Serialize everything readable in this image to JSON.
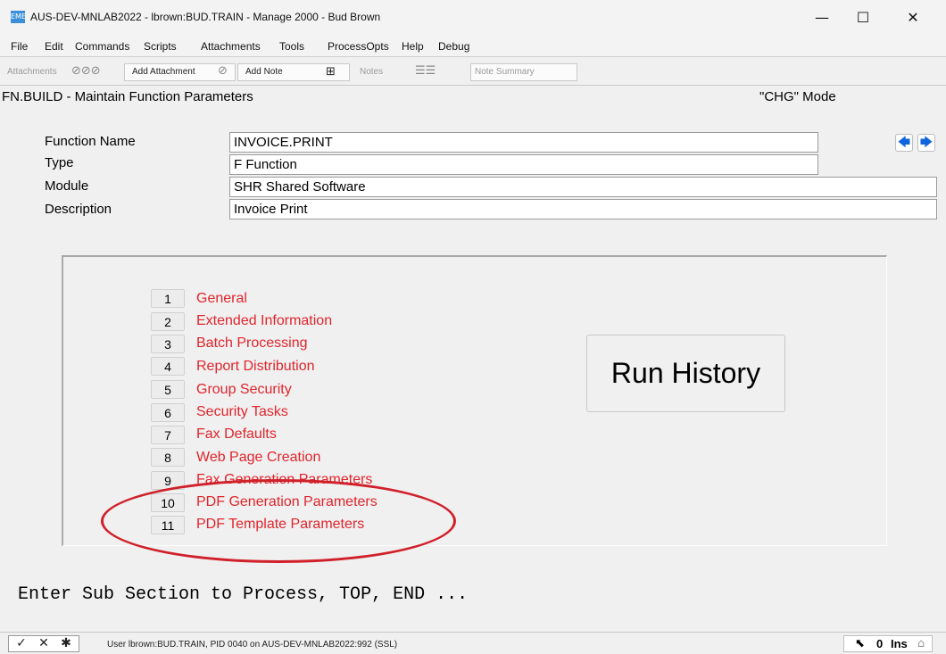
{
  "window": {
    "icon_text": "EME",
    "title": "AUS-DEV-MNLAB2022 - lbrown:BUD.TRAIN - Manage 2000 - Bud Brown",
    "minimize": "—",
    "maximize": "☐",
    "close": "✕"
  },
  "menu": [
    "File",
    "Edit",
    "Commands",
    "Scripts",
    "Attachments",
    "Tools",
    "ProcessOpts",
    "Help",
    "Debug"
  ],
  "toolbar": {
    "attachments_label": "Attachments",
    "add_attachment_label": "Add Attachment",
    "add_note_label": "Add Note",
    "notes_label": "Notes",
    "note_summary_label": "Note Summary"
  },
  "screen": {
    "title": "FN.BUILD - Maintain Function Parameters",
    "mode": "\"CHG\" Mode"
  },
  "fields": {
    "function_name": {
      "label": "Function Name",
      "value": "INVOICE.PRINT"
    },
    "type": {
      "label": "Type",
      "value": "F Function"
    },
    "module": {
      "label": "Module",
      "value": "SHR  Shared Software"
    },
    "description": {
      "label": "Description",
      "value": "Invoice Print"
    }
  },
  "nav": {
    "prev": "🡄",
    "next": "🡆"
  },
  "options": [
    {
      "num": "1",
      "label": "General"
    },
    {
      "num": "2",
      "label": "Extended Information"
    },
    {
      "num": "3",
      "label": "Batch Processing"
    },
    {
      "num": "4",
      "label": "Report Distribution"
    },
    {
      "num": "5",
      "label": "Group Security"
    },
    {
      "num": "6",
      "label": "Security Tasks"
    },
    {
      "num": "7",
      "label": "Fax Defaults"
    },
    {
      "num": "8",
      "label": "Web Page Creation"
    },
    {
      "num": "9",
      "label": "Fax Generation Parameters"
    },
    {
      "num": "10",
      "label": "PDF Generation Parameters"
    },
    {
      "num": "11",
      "label": "PDF Template Parameters"
    }
  ],
  "run_history_label": "Run History",
  "prompt": "Enter Sub Section to Process, TOP, END ...",
  "status": {
    "ok": "✓",
    "cancel": "✕",
    "star": "✱",
    "user_info": "User lbrown:BUD.TRAIN, PID 0040 on AUS-DEV-MNLAB2022:992 (SSL)",
    "count": "0",
    "ins": "Ins"
  },
  "colors": {
    "option_text": "#e0252c",
    "annotation_circle": "#d0202a",
    "nav_arrow": "#1166dd"
  }
}
